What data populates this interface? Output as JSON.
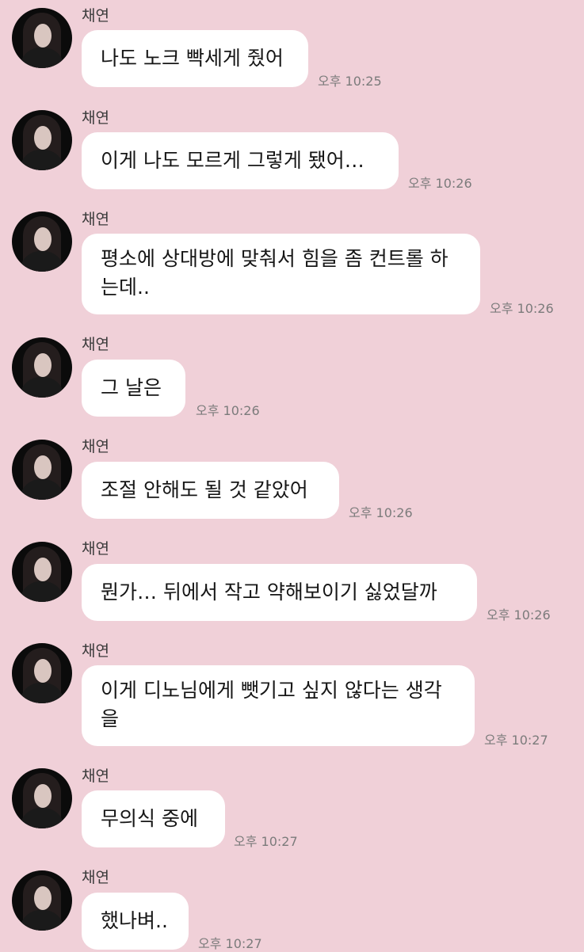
{
  "messages": [
    {
      "sender": "채연",
      "text": "나도 노크 빡세게 줬어",
      "time": "오후 10:25"
    },
    {
      "sender": "채연",
      "text": "이게 나도 모르게 그렇게 됐어…",
      "time": "오후 10:26"
    },
    {
      "sender": "채연",
      "text_lines": [
        "평소에 상대방에 맞춰서 힘을 좀 컨트롤 하",
        "는데.."
      ],
      "time": "오후 10:26"
    },
    {
      "sender": "채연",
      "text": "그 날은",
      "time": "오후 10:26"
    },
    {
      "sender": "채연",
      "text": "조절 안해도 될 것 같았어",
      "time": "오후 10:26"
    },
    {
      "sender": "채연",
      "text": "뭔가… 뒤에서 작고 약해보이기 싫었달까",
      "time": "오후 10:26"
    },
    {
      "sender": "채연",
      "text_lines": [
        "이게 디노님에게 뺏기고 싶지 않다는 생각",
        "을"
      ],
      "time": "오후 10:27"
    },
    {
      "sender": "채연",
      "text": "무의식 중에",
      "time": "오후 10:27"
    },
    {
      "sender": "채연",
      "text": "했나벼..",
      "time": "오후 10:27"
    }
  ]
}
